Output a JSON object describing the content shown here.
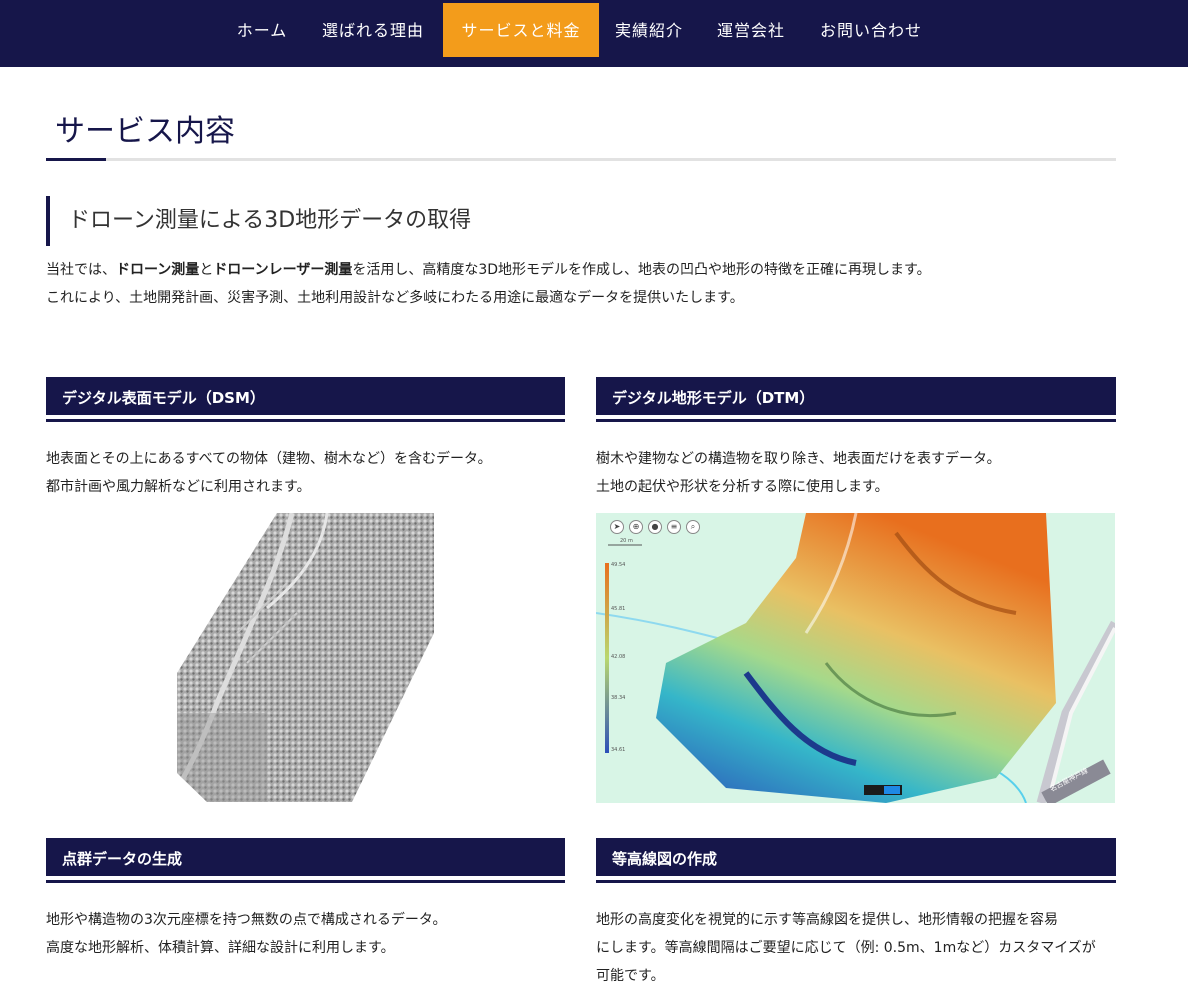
{
  "nav": {
    "items": [
      "ホーム",
      "選ばれる理由",
      "サービスと料金",
      "実績紹介",
      "運営会社",
      "お問い合わせ"
    ],
    "active": "サービスと料金"
  },
  "page_title": "サービス内容",
  "section": {
    "heading": "ドローン測量による3D地形データの取得",
    "line1_before": "当社では、",
    "line1_bold1": "ドローン測量",
    "line1_mid": "と",
    "line1_bold2": "ドローンレーザー測量",
    "line1_after": "を活用し、高精度な3D地形モデルを作成し、地表の凹凸や地形の特徴を正確に再現します。",
    "line2": "これにより、土地開発計画、災害予測、土地利用設計など多岐にわたる用途に最適なデータを提供いたします。"
  },
  "cards": {
    "dsm": {
      "title": "デジタル表面モデル（DSM）",
      "line1": "地表面とその上にあるすべての物体（建物、樹木など）を含むデータ。",
      "line2": "都市計画や風力解析などに利用されます。"
    },
    "dtm": {
      "title": "デジタル地形モデル（DTM）",
      "line1": "樹木や建物などの構造物を取り除き、地表面だけを表すデータ。",
      "line2": "土地の起伏や形状を分析する際に使用します。",
      "map_scale": "20 m",
      "legend": [
        "49.54",
        "45.81",
        "42.08",
        "38.34",
        "34.61"
      ],
      "road_label": "名古屋神戸線"
    },
    "point_cloud": {
      "title": "点群データの生成",
      "line1": "地形や構造物の3次元座標を持つ無数の点で構成されるデータ。",
      "line2": "高度な地形解析、体積計算、詳細な設計に利用します。"
    },
    "contour": {
      "title": "等高線図の作成",
      "line1": "地形の高度変化を視覚的に示す等高線図を提供し、地形情報の把握を容易",
      "line2": "にします。等高線間隔はご要望に応じて（例: 0.5m、1mなど）カスタマイズが",
      "line3": "可能です。"
    }
  },
  "colors": {
    "navy": "#16164a",
    "accent": "#f39c1b"
  }
}
